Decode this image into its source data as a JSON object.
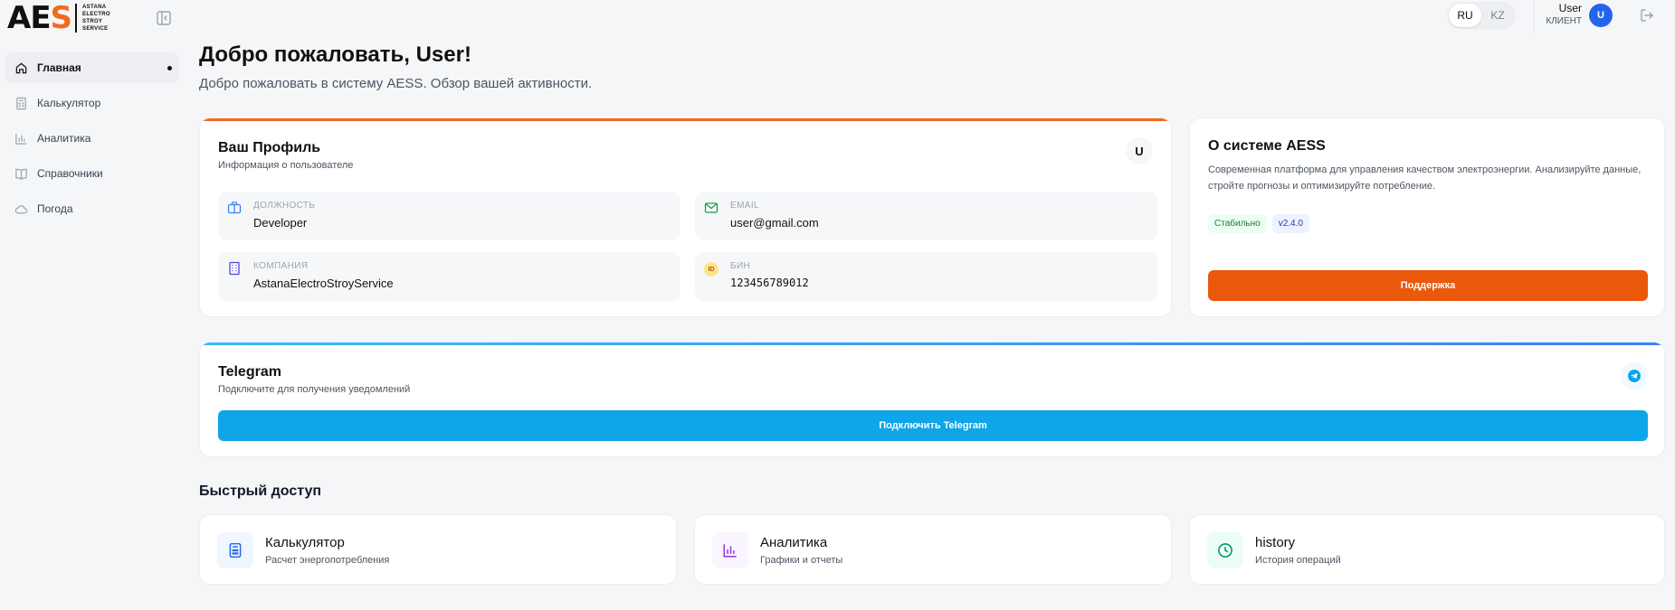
{
  "brand": {
    "logo_letters": "AE",
    "logo_s": "S",
    "logo_text": [
      "ASTANA",
      "ELECTRO",
      "STROY",
      "SERVICE"
    ],
    "accent_color": "#f26a21"
  },
  "header": {
    "languages": [
      {
        "label": "RU",
        "active": true
      },
      {
        "label": "KZ",
        "active": false
      }
    ],
    "user_name": "User",
    "user_role": "КЛИЕНТ",
    "avatar_letter": "U"
  },
  "sidebar": {
    "items": [
      {
        "label": "Главная",
        "icon": "home-icon",
        "active": true
      },
      {
        "label": "Калькулятор",
        "icon": "calculator-icon",
        "active": false
      },
      {
        "label": "Аналитика",
        "icon": "bar-chart-icon",
        "active": false
      },
      {
        "label": "Справочники",
        "icon": "book-icon",
        "active": false
      },
      {
        "label": "Погода",
        "icon": "cloud-icon",
        "active": false
      }
    ]
  },
  "main": {
    "title": "Добро пожаловать, User!",
    "subtitle": "Добро пожаловать в систему AESS. Обзор вашей активности."
  },
  "profile": {
    "title": "Ваш Профиль",
    "subtitle": "Информация о пользователе",
    "chip": "U",
    "fields": [
      {
        "label": "ДОЛЖНОСТЬ",
        "value": "Developer",
        "icon": "briefcase-icon"
      },
      {
        "label": "EMAIL",
        "value": "user@gmail.com",
        "icon": "mail-icon"
      },
      {
        "label": "КОМПАНИЯ",
        "value": "AstanaElectroStroyService",
        "icon": "building-icon"
      },
      {
        "label": "БИН",
        "value": "123456789012",
        "icon": "id-icon",
        "icon_text": "ID"
      }
    ]
  },
  "about": {
    "title": "О системе AESS",
    "description": "Современная платформа для управления качеством электроэнергии. Анализируйте данные, стройте прогнозы и оптимизируйте потребление.",
    "badges": [
      "Стабильно",
      "v2.4.0"
    ],
    "support_button": "Поддержка",
    "button_color": "#ea580c"
  },
  "telegram": {
    "title": "Telegram",
    "subtitle": "Подключите для получения уведомлений",
    "button": "Подключить Telegram",
    "button_color": "#0ea5e9"
  },
  "quick_access": {
    "title": "Быстрый доступ",
    "items": [
      {
        "title": "Калькулятор",
        "subtitle": "Расчет энергопотребления",
        "icon": "calculator-icon"
      },
      {
        "title": "Аналитика",
        "subtitle": "Графики и отчеты",
        "icon": "bar-chart-icon"
      },
      {
        "title": "history",
        "subtitle": "История операций",
        "icon": "clock-icon"
      }
    ]
  }
}
